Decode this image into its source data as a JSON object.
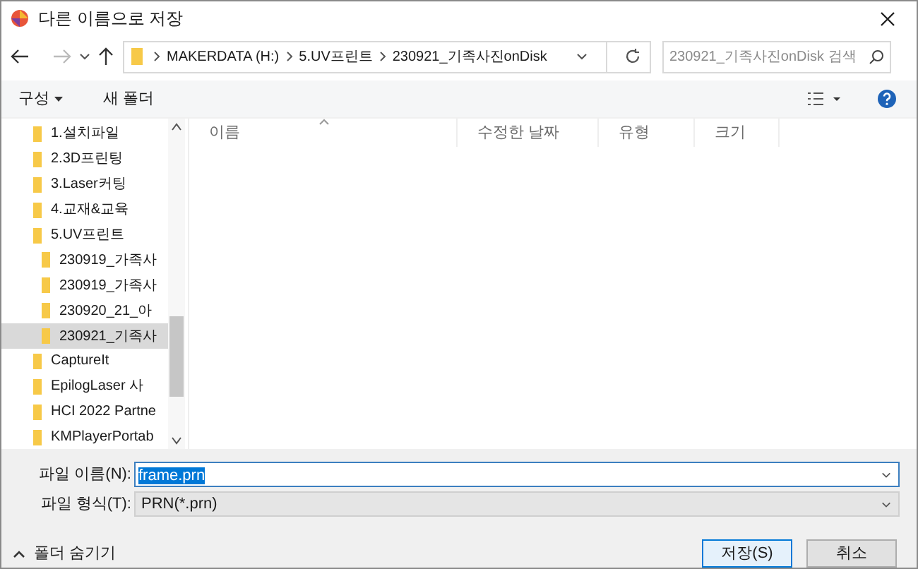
{
  "window": {
    "title": "다른 이름으로 저장"
  },
  "address_bar": {
    "path": [
      "MAKERDATA (H:)",
      "5.UV프린트",
      "230921_기족사진onDisk"
    ]
  },
  "search": {
    "placeholder": "230921_기족사진onDisk 검색"
  },
  "toolbar": {
    "organize": "구성",
    "new_folder": "새 폴더"
  },
  "sidebar": {
    "items": [
      {
        "label": "1.설치파일",
        "selected": false
      },
      {
        "label": "2.3D프린팅",
        "selected": false
      },
      {
        "label": "3.Laser커팅",
        "selected": false
      },
      {
        "label": "4.교재&교육",
        "selected": false
      },
      {
        "label": "5.UV프린트",
        "selected": false,
        "children": [
          {
            "label": "230919_가족사",
            "selected": false
          },
          {
            "label": "230919_가족사",
            "selected": false
          },
          {
            "label": "230920_21_아",
            "selected": false
          },
          {
            "label": "230921_기족사",
            "selected": true
          }
        ]
      },
      {
        "label": "CaptureIt",
        "selected": false
      },
      {
        "label": "EpilogLaser 사",
        "selected": false
      },
      {
        "label": "HCI 2022 Partne",
        "selected": false
      },
      {
        "label": "KMPlayerPortab",
        "selected": false
      }
    ]
  },
  "table": {
    "columns": [
      "이름",
      "수정한 날짜",
      "유형",
      "크기"
    ]
  },
  "file_name": {
    "label": "파일 이름(N):",
    "value": "frame.prn"
  },
  "file_type": {
    "label": "파일 형식(T):",
    "value": "PRN(*.prn)"
  },
  "hide_folders": "폴더 숨기기",
  "buttons": [
    {
      "label": "저장(S)",
      "kind": "primary"
    },
    {
      "label": "취소",
      "kind": "secondary"
    }
  ]
}
